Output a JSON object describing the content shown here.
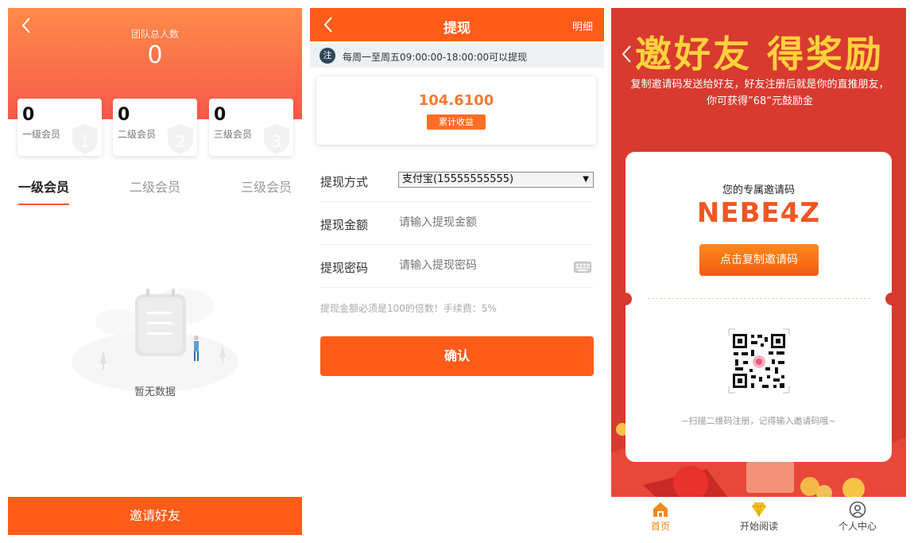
{
  "team": {
    "total_label": "团队总人数",
    "total_count": "0",
    "levels": [
      {
        "count": "0",
        "label": "一级会员",
        "badge": "1"
      },
      {
        "count": "0",
        "label": "二级会员",
        "badge": "2"
      },
      {
        "count": "0",
        "label": "三级会员",
        "badge": "3"
      }
    ],
    "tabs": [
      "一级会员",
      "二级会员",
      "三级会员"
    ],
    "empty_text": "暂无数据",
    "invite_button": "邀请好友"
  },
  "withdraw": {
    "title": "提现",
    "detail_link": "明细",
    "notice_badge": "注",
    "notice_text": "每周一至周五09:00:00-18:00:00可以提现",
    "earnings_value": "104.6100",
    "earnings_tag": "累计收益",
    "method_label": "提现方式",
    "method_value": "支付宝(15555555555)",
    "amount_label": "提现金额",
    "amount_placeholder": "请输入提现金额",
    "password_label": "提现密码",
    "password_placeholder": "请输入提现密码",
    "hint": "提现金额必须是100的倍数！手续费：5%",
    "confirm_button": "确认"
  },
  "invite": {
    "headline": "邀好友 得奖励",
    "description": "复制邀请码发送给好友，好友注册后就是你的直推朋友，你可获得”68“元鼓励金",
    "card_title": "您的专属邀请码",
    "code": "NEBE4Z",
    "copy_button": "点击复制邀请码",
    "scan_text": "~扫描二维码注册，记得输入邀请码哦~",
    "tabbar": [
      {
        "label": "首页",
        "icon": "home-icon"
      },
      {
        "label": "开始阅读",
        "icon": "diamond-icon"
      },
      {
        "label": "个人中心",
        "icon": "user-icon"
      }
    ]
  },
  "colors": {
    "accent_orange": "#ff5c1a",
    "invite_red": "#d83a30",
    "headline_yellow": "#ffd23c"
  }
}
